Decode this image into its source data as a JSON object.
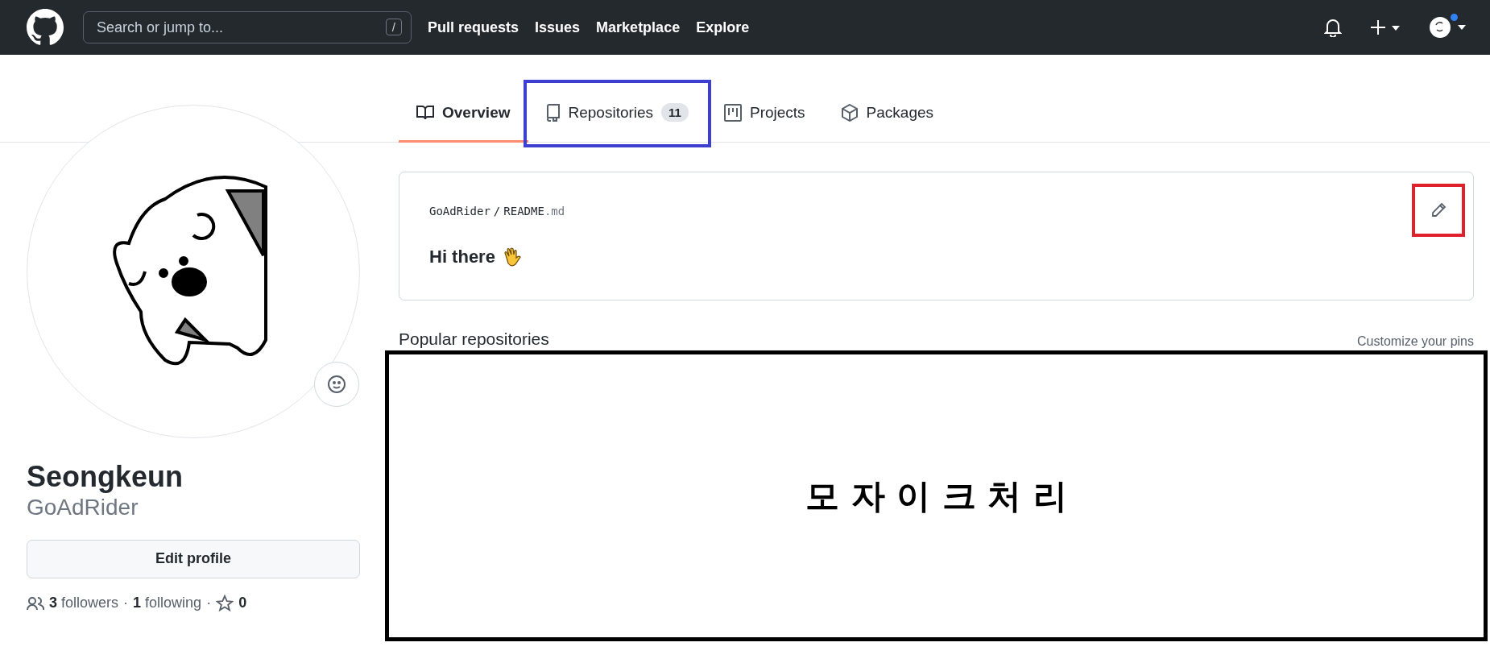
{
  "header": {
    "search": {
      "placeholder": "Search or jump to...",
      "shortcut": "/"
    },
    "nav": [
      "Pull requests",
      "Issues",
      "Marketplace",
      "Explore"
    ],
    "notification_dot": true
  },
  "tabs": [
    {
      "label": "Overview",
      "kind": "book",
      "selected": true,
      "annotated": false
    },
    {
      "label": "Repositories",
      "kind": "repo",
      "count": "11",
      "selected": false,
      "annotated": true
    },
    {
      "label": "Projects",
      "kind": "project",
      "selected": false,
      "annotated": false
    },
    {
      "label": "Packages",
      "kind": "package",
      "selected": false,
      "annotated": false
    }
  ],
  "profile": {
    "name": "Seongkeun",
    "login": "GoAdRider",
    "edit_button": "Edit profile",
    "followers_count": "3",
    "followers_label": "followers",
    "following_count": "1",
    "following_label": "following",
    "stat_separators": [
      "·",
      "·"
    ],
    "stars_count": "0"
  },
  "readme": {
    "owner": "GoAdRider",
    "separator": "/",
    "file_base": "README",
    "file_ext": ".md",
    "greeting": "Hi there",
    "edit_annotated": true
  },
  "popular": {
    "title": "Popular repositories",
    "customize_link": "Customize your pins",
    "mosaic_text": "모 자 이 크 처 리"
  }
}
